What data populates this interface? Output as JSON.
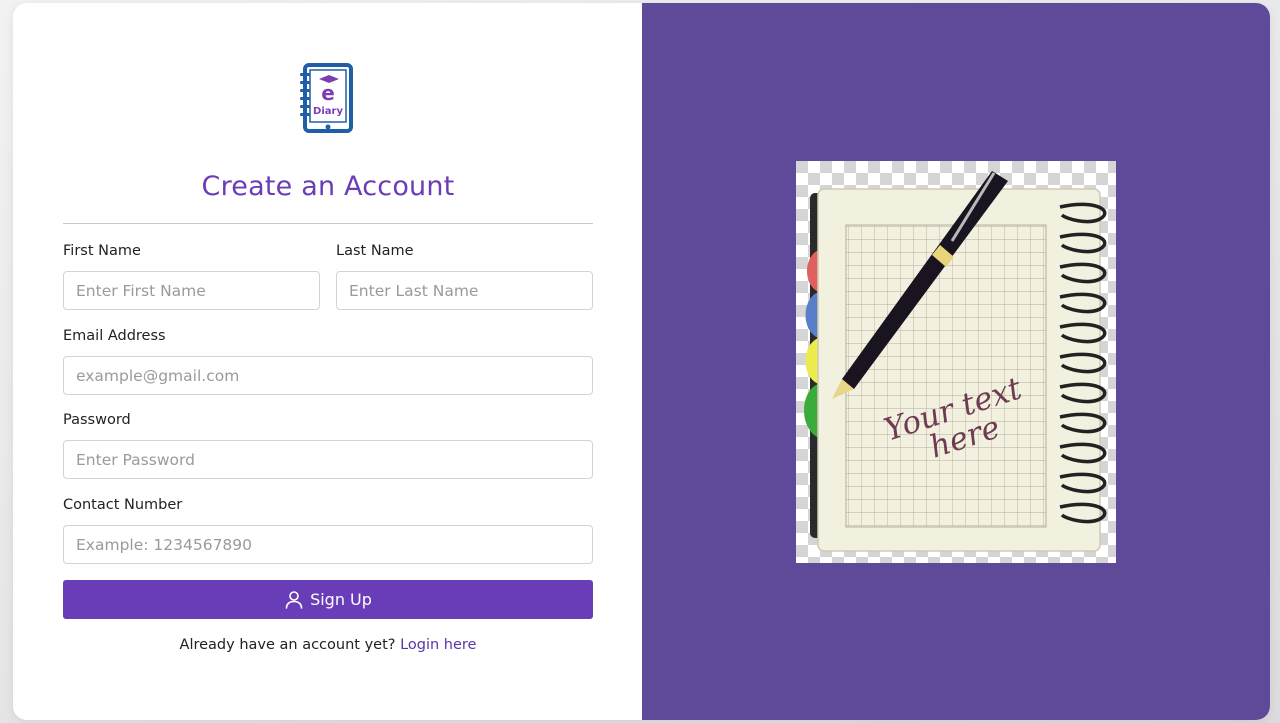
{
  "brand": {
    "logo_letter": "e",
    "logo_text": "Diary"
  },
  "form": {
    "title": "Create an Account",
    "first_name": {
      "label": "First Name",
      "placeholder": "Enter First Name"
    },
    "last_name": {
      "label": "Last Name",
      "placeholder": "Enter Last Name"
    },
    "email": {
      "label": "Email Address",
      "placeholder": "example@gmail.com"
    },
    "password": {
      "label": "Password",
      "placeholder": "Enter Password"
    },
    "contact": {
      "label": "Contact Number",
      "placeholder": "Example: 1234567890"
    },
    "submit_label": "Sign Up",
    "footer_text": "Already have an account yet?",
    "login_link": "Login here"
  },
  "illustration": {
    "caption_line1": "Your text",
    "caption_line2": "here"
  },
  "colors": {
    "accent": "#6a3db8",
    "panel": "#5f4a9a",
    "logo_blue": "#1f5fa8"
  }
}
